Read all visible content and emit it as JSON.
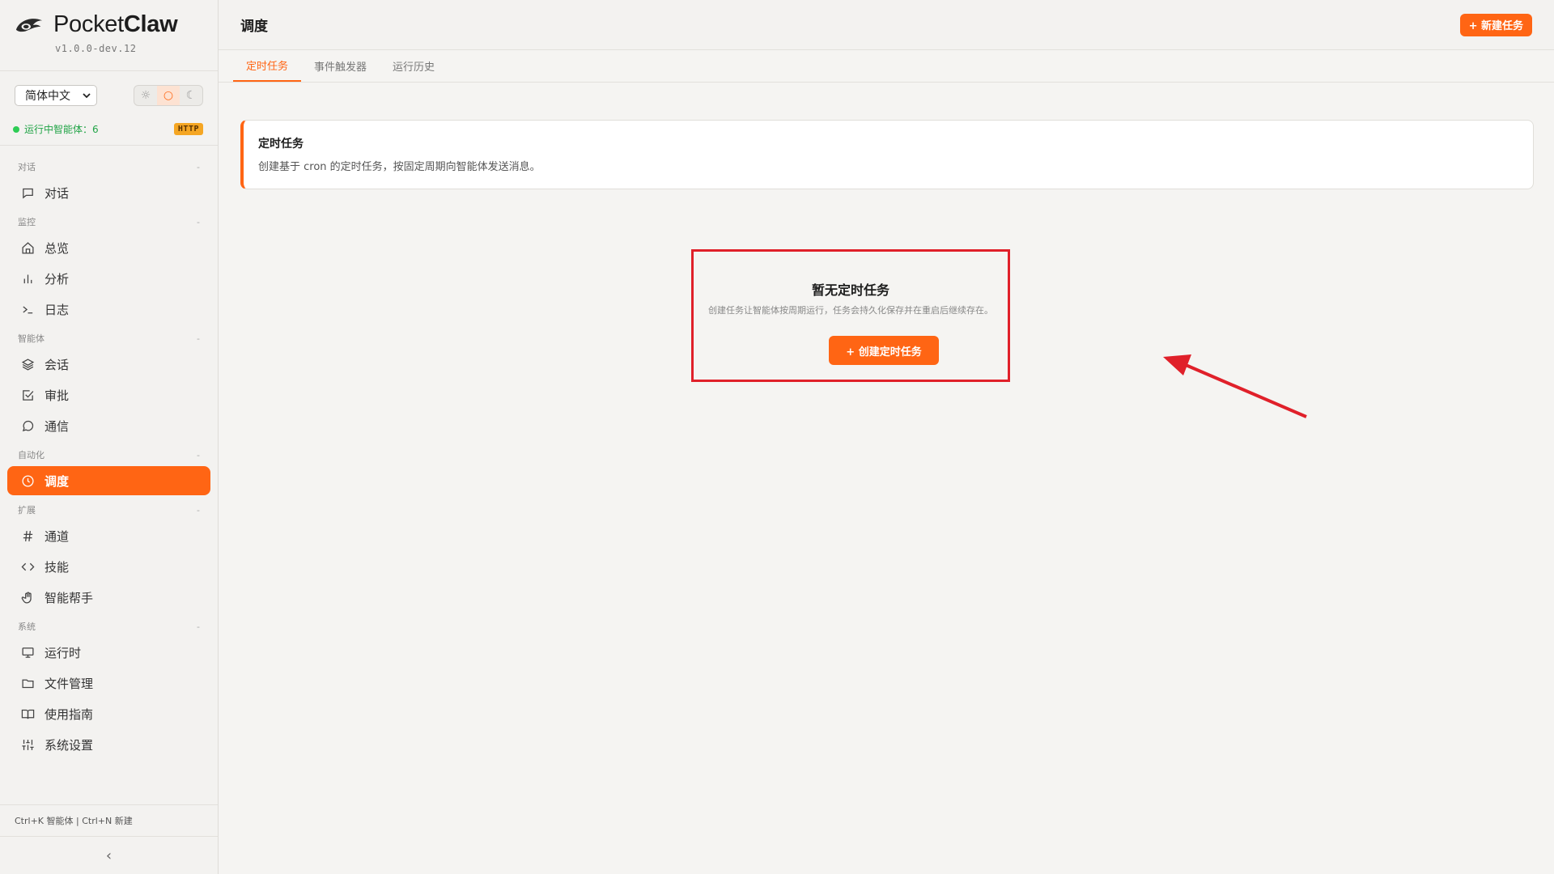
{
  "app": {
    "name_light": "Pocket",
    "name_bold": "Claw",
    "version": "v1.0.0-dev.12"
  },
  "controls": {
    "language": "简体中文",
    "theme_icons": [
      "sun-icon",
      "circle-icon",
      "moon-icon"
    ],
    "active_theme": "circle-icon"
  },
  "status": {
    "running_label": "运行中智能体：6",
    "protocol_badge": "HTTP"
  },
  "sidebar": {
    "sections": [
      {
        "label": "对话",
        "items": [
          {
            "label": "对话",
            "icon": "chat-icon"
          }
        ]
      },
      {
        "label": "监控",
        "items": [
          {
            "label": "总览",
            "icon": "home-icon"
          },
          {
            "label": "分析",
            "icon": "bar-chart-icon"
          },
          {
            "label": "日志",
            "icon": "terminal-icon"
          }
        ]
      },
      {
        "label": "智能体",
        "items": [
          {
            "label": "会话",
            "icon": "layers-icon"
          },
          {
            "label": "审批",
            "icon": "check-square-icon"
          },
          {
            "label": "通信",
            "icon": "message-circle-icon"
          }
        ]
      },
      {
        "label": "自动化",
        "items": [
          {
            "label": "调度",
            "icon": "clock-icon",
            "active": true
          }
        ]
      },
      {
        "label": "扩展",
        "items": [
          {
            "label": "通道",
            "icon": "hash-icon"
          },
          {
            "label": "技能",
            "icon": "code-icon"
          },
          {
            "label": "智能帮手",
            "icon": "hand-icon"
          }
        ]
      },
      {
        "label": "系统",
        "items": [
          {
            "label": "运行时",
            "icon": "monitor-icon"
          },
          {
            "label": "文件管理",
            "icon": "folder-icon"
          },
          {
            "label": "使用指南",
            "icon": "book-icon"
          },
          {
            "label": "系统设置",
            "icon": "sliders-icon"
          }
        ]
      }
    ],
    "collapse_marker": "-",
    "shortcuts": "Ctrl+K 智能体 | Ctrl+N 新建",
    "collapse_glyph": "‹"
  },
  "header": {
    "title": "调度",
    "new_task_button": "+ 新建任务"
  },
  "tabs": [
    {
      "label": "定时任务",
      "active": true
    },
    {
      "label": "事件触发器"
    },
    {
      "label": "运行历史"
    }
  ],
  "info_card": {
    "title": "定时任务",
    "description": "创建基于 cron 的定时任务，按固定周期向智能体发送消息。"
  },
  "empty_state": {
    "title": "暂无定时任务",
    "description": "创建任务让智能体按周期运行，任务会持久化保存并在重启后继续存在。",
    "button": "+ 创建定时任务"
  },
  "colors": {
    "accent": "#ff6514",
    "highlight_box": "#e0202a",
    "status_green": "#2ecc55"
  }
}
